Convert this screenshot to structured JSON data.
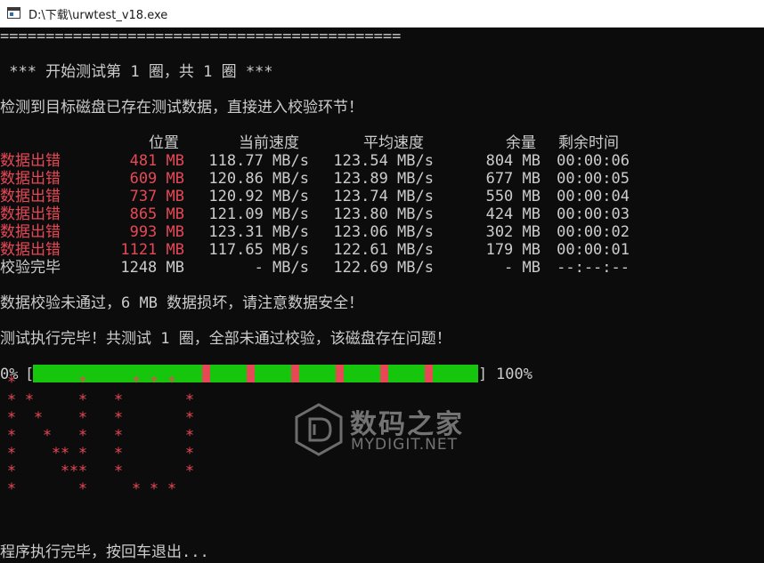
{
  "window": {
    "title": "D:\\下载\\urwtest_v18.exe"
  },
  "console": {
    "separator": "============================================",
    "round_header": " *** 开始测试第 1 圈，共 1 圈 ***",
    "detect_msg": "检测到目标磁盘已存在测试数据，直接进入校验环节！",
    "table": {
      "headers": [
        "位置",
        "当前速度",
        "平均速度",
        "余量",
        "剩余时间"
      ],
      "rows": [
        {
          "status": "数据出错",
          "pos": "481 MB",
          "cur": "118.77 MB/s",
          "avg": "123.54 MB/s",
          "rem": "804 MB",
          "time": "00:00:06",
          "error": true
        },
        {
          "status": "数据出错",
          "pos": "609 MB",
          "cur": "120.86 MB/s",
          "avg": "123.89 MB/s",
          "rem": "677 MB",
          "time": "00:00:05",
          "error": true
        },
        {
          "status": "数据出错",
          "pos": "737 MB",
          "cur": "120.92 MB/s",
          "avg": "123.74 MB/s",
          "rem": "550 MB",
          "time": "00:00:04",
          "error": true
        },
        {
          "status": "数据出错",
          "pos": "865 MB",
          "cur": "121.09 MB/s",
          "avg": "123.80 MB/s",
          "rem": "424 MB",
          "time": "00:00:03",
          "error": true
        },
        {
          "status": "数据出错",
          "pos": "993 MB",
          "cur": "123.31 MB/s",
          "avg": "123.06 MB/s",
          "rem": "302 MB",
          "time": "00:00:02",
          "error": true
        },
        {
          "status": "数据出错",
          "pos": "1121 MB",
          "cur": "117.65 MB/s",
          "avg": "122.61 MB/s",
          "rem": "179 MB",
          "time": "00:00:01",
          "error": true
        },
        {
          "status": "校验完毕",
          "pos": "1248 MB",
          "cur": "- MB/s",
          "avg": "122.69 MB/s",
          "rem": "- MB",
          "time": "--:--:--",
          "error": false
        }
      ]
    },
    "verify_fail_msg": "数据校验未通过，6 MB 数据损坏，请注意数据安全！",
    "summary_msg": "测试执行完毕！共测试 1 圈，全部未通过校验，该磁盘存在问题！",
    "progress": {
      "start_label": "0%",
      "open_bracket": "[",
      "close_bracket": "]",
      "end_label": "100%",
      "value_percent": 100,
      "segments": 10,
      "bad_segment_boundaries": [
        4,
        5,
        6,
        7,
        8,
        9
      ],
      "good_color": "#16c60c",
      "bad_color": "#e74856"
    },
    "ng_art": "NO",
    "exit_msg": "程序执行完毕，按回车退出..."
  },
  "watermark": {
    "name": "数码之家",
    "url": "MYDIGIT.NET",
    "icon": "mydigit-logo-icon"
  },
  "colors": {
    "background": "#0c0c0c",
    "text": "#cccccc",
    "error": "#e74856",
    "progress_ok": "#16c60c"
  }
}
